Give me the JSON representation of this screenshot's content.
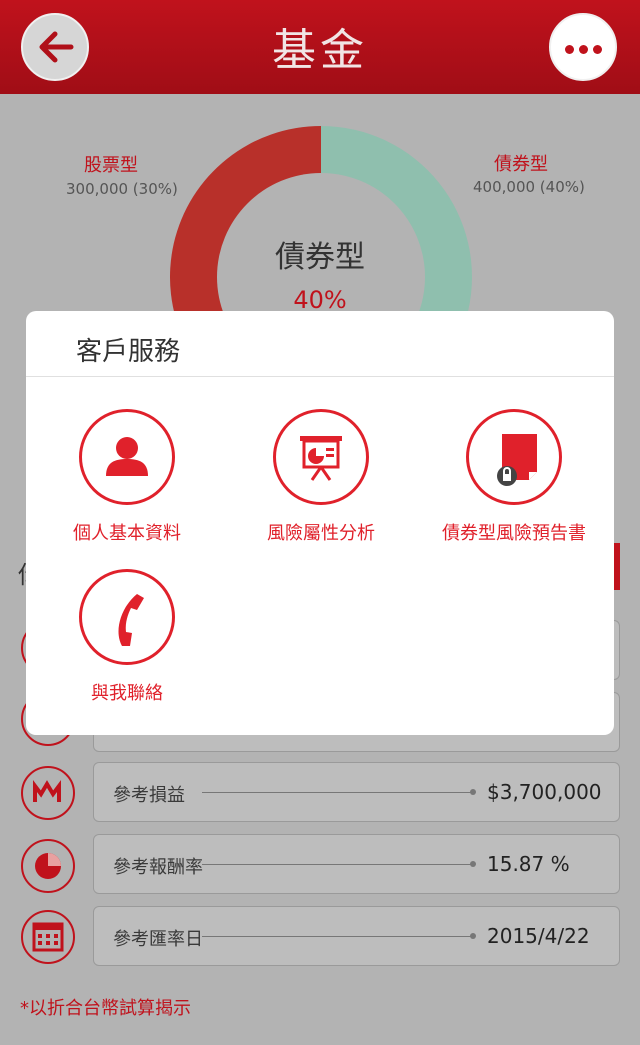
{
  "header": {
    "title": "基金"
  },
  "donut": {
    "left_label": "股票型",
    "left_sub": "300,000 (30%)",
    "right_label": "債券型",
    "right_sub": "400,000 (40%)",
    "center_title": "債券型",
    "center_pct": "40%"
  },
  "chart_data": {
    "type": "pie",
    "categories": [
      "股票型",
      "債券型"
    ],
    "values": [
      300000,
      400000
    ],
    "percent": [
      30,
      40
    ],
    "colors": [
      "#c0262b",
      "#7fb7a3"
    ]
  },
  "modal": {
    "title": "客戶服務",
    "items": [
      {
        "label": "個人基本資料",
        "icon": "person-icon"
      },
      {
        "label": "風險屬性分析",
        "icon": "presentation-chart-icon"
      },
      {
        "label": "債券型風險預告書",
        "icon": "locked-document-icon"
      },
      {
        "label": "與我聯絡",
        "icon": "phone-icon"
      }
    ]
  },
  "rows": [
    {
      "label": "參考損益",
      "value": "$3,700,000",
      "icon": "chart-bars-icon"
    },
    {
      "label": "參考報酬率",
      "value": "15.87 %",
      "icon": "pie-chart-icon"
    },
    {
      "label": "參考匯率日",
      "value": "2015/4/22",
      "icon": "calendar-icon"
    }
  ],
  "footnote": "*以折合台幣試算揭示",
  "colors": {
    "brand": "#c0121c",
    "accent": "#e0212b",
    "bond": "#7fb7a3"
  }
}
